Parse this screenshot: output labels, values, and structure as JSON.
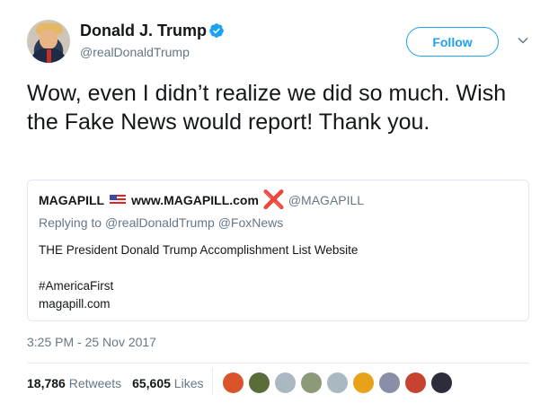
{
  "author": {
    "name": "Donald J. Trump",
    "handle": "@realDonaldTrump",
    "verified_icon": "verified-badge-icon"
  },
  "header": {
    "follow_label": "Follow",
    "menu_icon": "chevron-down-icon"
  },
  "tweet": {
    "text": "Wow, even I didn’t realize we did so much. Wish the Fake News would report! Thank you."
  },
  "quote": {
    "name": "MAGAPILL",
    "site": "www.MAGAPILL.com",
    "x_mark": "❌",
    "handle": "@MAGAPILL",
    "replying_prefix": "Replying to",
    "reply_handle_1": "@realDonaldTrump",
    "reply_handle_2": "@FoxNews",
    "line1": "THE President Donald Trump Accomplishment List Website",
    "line2": "#AmericaFirst",
    "line3": "magapill.com"
  },
  "timestamp": "3:25 PM - 25 Nov 2017",
  "stats": {
    "retweets_count": "18,786",
    "retweets_label": "Retweets",
    "likes_count": "65,605",
    "likes_label": "Likes"
  },
  "facepile": {
    "colors": [
      "#d9542a",
      "#5b6b3a",
      "#aab8c2",
      "#8c9a7a",
      "#aab8c2",
      "#e7a21a",
      "#8a8ea6",
      "#c8432f",
      "#2c2c3a"
    ]
  },
  "colors": {
    "accent": "#1da1f2",
    "secondary_text": "#657786",
    "primary_text": "#14171a",
    "border": "#e1e8ed"
  }
}
